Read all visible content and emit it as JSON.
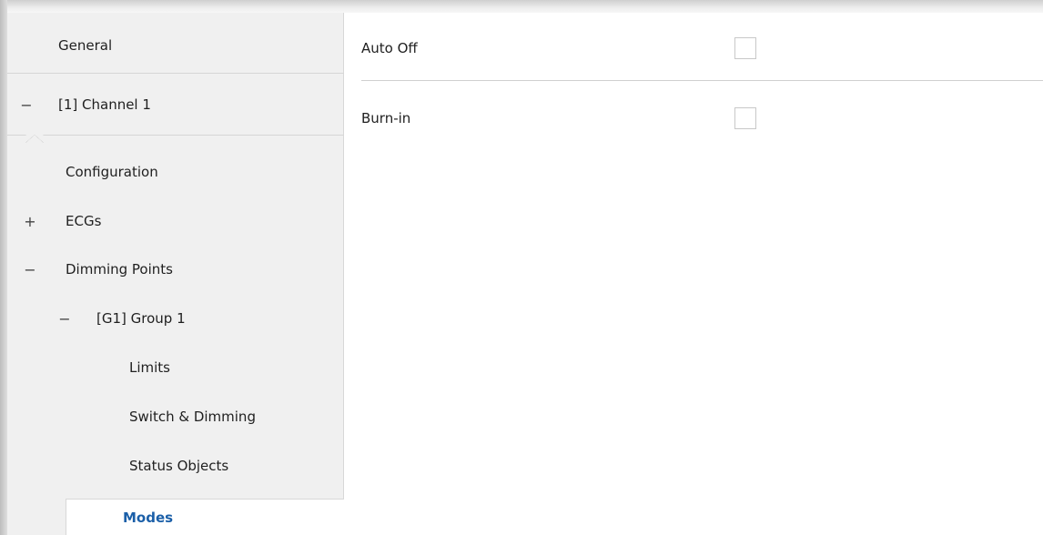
{
  "sidebar": {
    "items": [
      {
        "label": "General",
        "toggle": ""
      },
      {
        "label": "[1] Channel 1",
        "toggle": "−"
      },
      {
        "label": "Configuration",
        "toggle": ""
      },
      {
        "label": "ECGs",
        "toggle": "+"
      },
      {
        "label": "Dimming Points",
        "toggle": "−"
      },
      {
        "label": "[G1] Group 1",
        "toggle": "−"
      },
      {
        "label": "Limits",
        "toggle": ""
      },
      {
        "label": "Switch & Dimming",
        "toggle": ""
      },
      {
        "label": "Status Objects",
        "toggle": ""
      },
      {
        "label": "Modes",
        "toggle": "",
        "selected": true
      }
    ]
  },
  "content": {
    "params": [
      {
        "label": "Auto Off",
        "checked": false
      },
      {
        "label": "Burn-in",
        "checked": false
      }
    ]
  },
  "colors": {
    "selected_text": "#1b5fa8",
    "sidebar_bg": "#f0f0f0"
  }
}
